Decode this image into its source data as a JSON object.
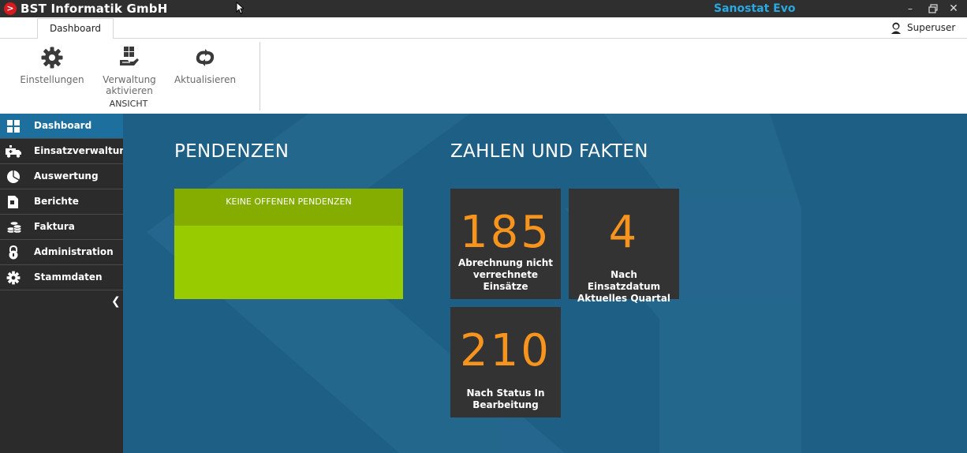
{
  "titlebar": {
    "company": "BST Informatik GmbH",
    "product": "Sanostat Evo",
    "product_color": "#29a9e0"
  },
  "ribbon": {
    "tab": "Dashboard",
    "user": "Superuser",
    "buttons": {
      "settings": "Einstellungen",
      "admin_line1": "Verwaltung",
      "admin_line2": "aktivieren",
      "refresh": "Aktualisieren"
    },
    "group_label": "ANSICHT"
  },
  "sidebar": {
    "items": [
      {
        "label": "Dashboard",
        "icon": "dashboard-grid-icon",
        "active": true
      },
      {
        "label": "Einsatzverwaltung",
        "icon": "ambulance-icon"
      },
      {
        "label": "Auswertung",
        "icon": "pie-chart-icon"
      },
      {
        "label": "Berichte",
        "icon": "report-document-icon"
      },
      {
        "label": "Faktura",
        "icon": "coins-icon"
      },
      {
        "label": "Administration",
        "icon": "padlock-icon"
      },
      {
        "label": "Stammdaten",
        "icon": "gear-icon"
      }
    ],
    "active_color": "#1d6f9e"
  },
  "main": {
    "pendenzen": {
      "title": "PENDENZEN",
      "empty_text": "KEINE OFFENEN PENDENZEN",
      "color": "#99cc00"
    },
    "facts": {
      "title": "ZAHLEN UND FAKTEN",
      "tiles": [
        {
          "value": "185",
          "label": "Abrechnung nicht verrechnete Einsätze"
        },
        {
          "value": "4",
          "label": "Nach Einsatzdatum Aktuelles Quartal"
        },
        {
          "value": "210",
          "label": "Nach Status In Bearbeitung"
        }
      ],
      "value_color": "#f7941d"
    },
    "background_color": "#1e5f86"
  }
}
